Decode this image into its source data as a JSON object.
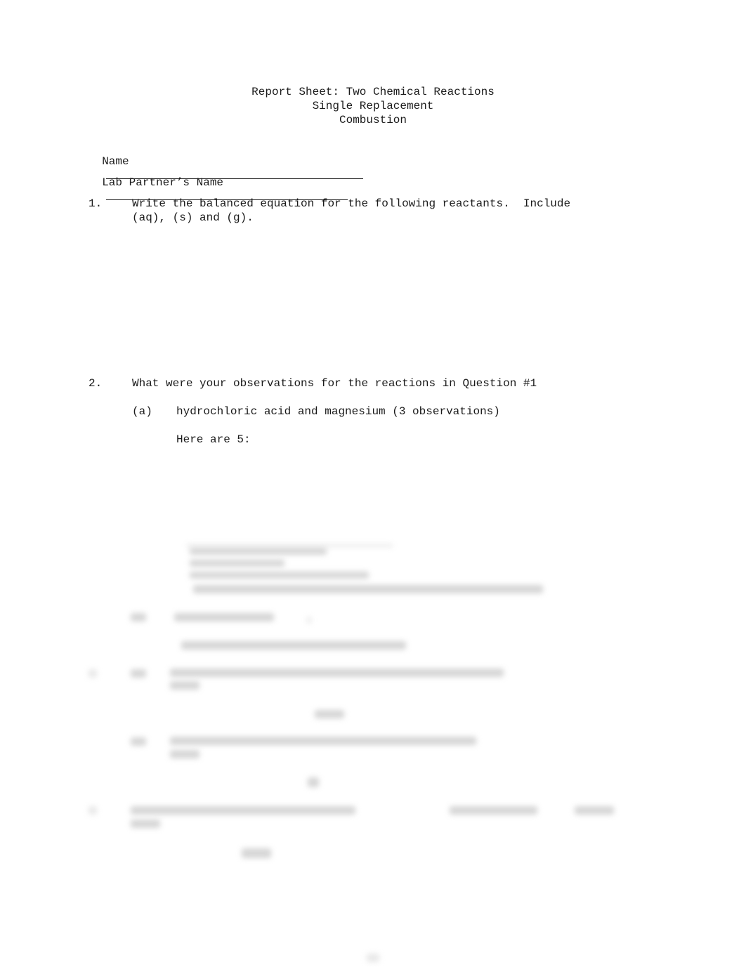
{
  "document": {
    "title_lines": [
      "Report Sheet: Two Chemical Reactions",
      "Single Replacement",
      "Combustion"
    ],
    "fields": {
      "name_label": "Name",
      "partner_label": "Lab Partner’s Name"
    },
    "questions": [
      {
        "number": "1.",
        "text_line1": "Write the balanced equation for the following reactants.  Include",
        "text_line2": "(aq), (s) and (g)."
      },
      {
        "number": "2.",
        "text": "What were your observations for the reactions in Question #1",
        "parts": [
          {
            "label": "(a)",
            "text": "hydrochloric acid and magnesium (3 observations)",
            "answer_intro": "Here are 5:"
          }
        ]
      }
    ],
    "blurred_preview": true
  }
}
